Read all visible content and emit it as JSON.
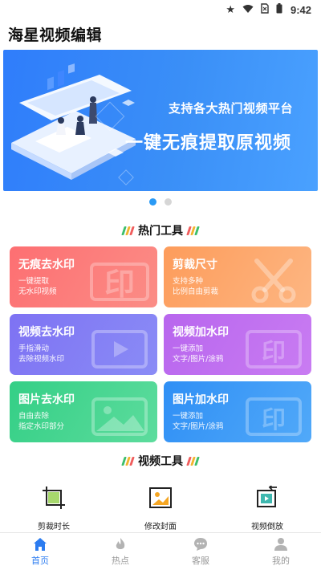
{
  "status_bar": {
    "time": "9:42",
    "icons": [
      "star-icon",
      "wifi-icon",
      "no-sim-icon",
      "battery-icon"
    ]
  },
  "header": {
    "title": "海星视频编辑"
  },
  "banner": {
    "line1": "支持各大热门视频平台",
    "line2": "一键无痕提取原视频",
    "colors": {
      "start": "#2f7dfb",
      "end": "#4aa1ff"
    },
    "carousel": {
      "pages": 2,
      "active_index": 0
    }
  },
  "hot_tools": {
    "title": "热门工具",
    "cards": [
      {
        "title": "无痕去水印",
        "sub1": "一键提取",
        "sub2": "无水印视频",
        "icon": "stamp-icon",
        "watermark_text": "印",
        "colors": [
          "#fd6f72",
          "#fb8d86"
        ]
      },
      {
        "title": "剪裁尺寸",
        "sub1": "支持多种",
        "sub2": "比例自由剪裁",
        "icon": "scissors-icon",
        "colors": [
          "#fd9c5b",
          "#fdb682"
        ]
      },
      {
        "title": "视频去水印",
        "sub1": "手指滑动",
        "sub2": "去除视频水印",
        "icon": "video-play-icon",
        "colors": [
          "#7e72f3",
          "#8a8cf6"
        ]
      },
      {
        "title": "视频加水印",
        "sub1": "一键添加",
        "sub2": "文字/图片/涂鸦",
        "icon": "video-stamp-icon",
        "watermark_text": "印",
        "colors": [
          "#b866ee",
          "#c97cf2"
        ]
      },
      {
        "title": "图片去水印",
        "sub1": "自由去除",
        "sub2": "指定水印部分",
        "icon": "image-icon",
        "colors": [
          "#34cf86",
          "#5ddc9d"
        ]
      },
      {
        "title": "图片加水印",
        "sub1": "一键添加",
        "sub2": "文字/图片/涂鸦",
        "icon": "image-stamp-icon",
        "watermark_text": "印",
        "colors": [
          "#2f8ff5",
          "#51a9f9"
        ]
      }
    ]
  },
  "video_tools": {
    "title": "视频工具",
    "items": [
      {
        "label": "剪裁时长",
        "icon": "crop-duration-icon"
      },
      {
        "label": "修改封面",
        "icon": "cover-image-icon"
      },
      {
        "label": "视频倒放",
        "icon": "reverse-play-icon"
      }
    ]
  },
  "bottom_nav": {
    "active_color": "#2c7cf0",
    "items": [
      {
        "label": "首页",
        "icon": "home-icon",
        "active": true
      },
      {
        "label": "热点",
        "icon": "flame-icon",
        "active": false
      },
      {
        "label": "客服",
        "icon": "chat-icon",
        "active": false
      },
      {
        "label": "我的",
        "icon": "user-icon",
        "active": false
      }
    ]
  }
}
